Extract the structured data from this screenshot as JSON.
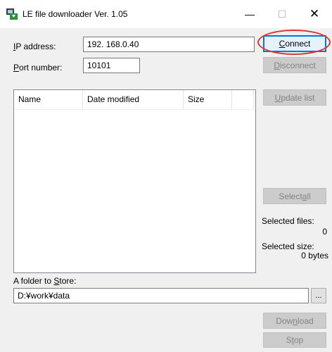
{
  "window": {
    "title": "LE file downloader Ver. 1.05",
    "min_glyph": "—",
    "max_glyph": "☐",
    "close_glyph": "✕"
  },
  "connection": {
    "ip_label_first": "I",
    "ip_label_rest": "P address:",
    "ip_value": "192. 168.0.40",
    "port_label_first": "P",
    "port_label_rest": "ort number:",
    "port_value": "10101",
    "connect_label_first": "C",
    "connect_label_rest": "onnect",
    "disconnect_label_first": "D",
    "disconnect_label_rest": "isconnect"
  },
  "file_list": {
    "columns": [
      "Name",
      "Date modified",
      "Size",
      ""
    ],
    "rows": []
  },
  "side": {
    "update_first": "U",
    "update_rest": "pdate list",
    "select_all_pre": "Select ",
    "select_all_u": "a",
    "select_all_post": "ll",
    "selected_files_label": "Selected files:",
    "selected_files_value": "0",
    "selected_size_label": "Selected size:",
    "selected_size_value": "0 bytes"
  },
  "store": {
    "label_pre": "A folder to ",
    "label_u": "S",
    "label_post": "tore:",
    "path": "D:¥work¥data",
    "browse_label": "...",
    "download_pre": "Dow",
    "download_u": "n",
    "download_post": "load",
    "stop_pre": "S",
    "stop_u": "t",
    "stop_post": "op"
  },
  "colors": {
    "highlight_ellipse": "#e03333",
    "focus_border": "#0078d7"
  }
}
